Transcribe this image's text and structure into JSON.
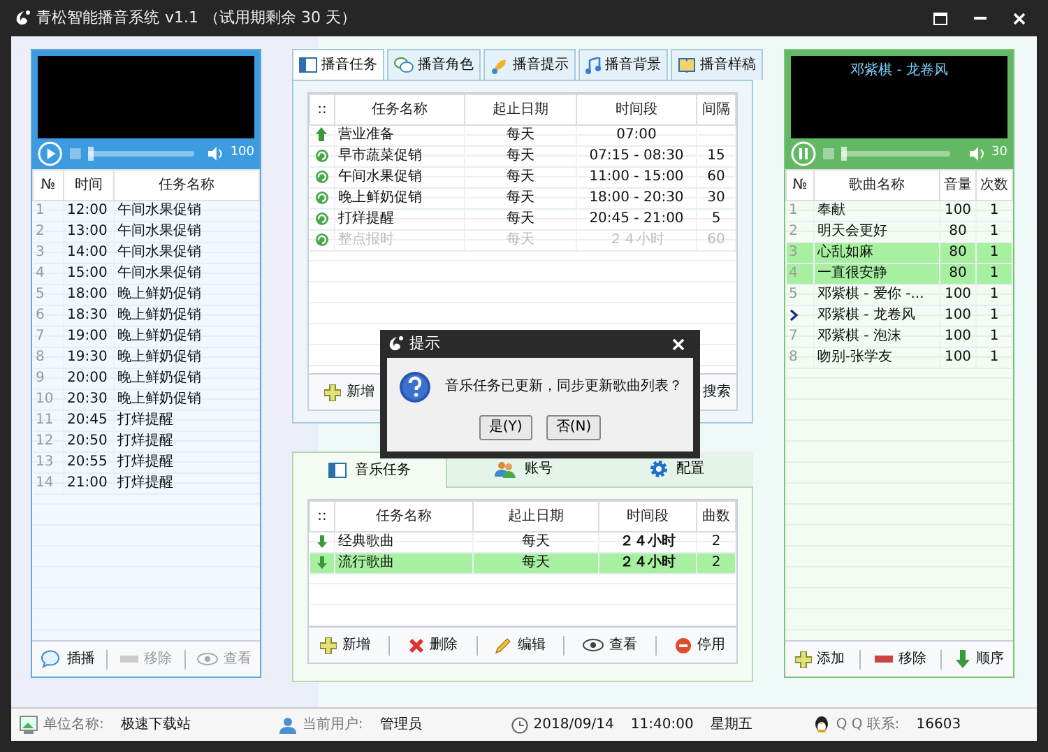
{
  "window": {
    "app_name": "青松智能播音系统",
    "version": "v1.1",
    "trial": "（试用期剩余 30 天）"
  },
  "left_player": {
    "playing": false,
    "seek": {
      "level": 0
    },
    "volume": "100"
  },
  "schedule": {
    "columns": [
      "№",
      "时间",
      "任务名称"
    ],
    "rows": [
      {
        "no": "1",
        "time": "12:00",
        "name": "午间水果促销"
      },
      {
        "no": "2",
        "time": "13:00",
        "name": "午间水果促销"
      },
      {
        "no": "3",
        "time": "14:00",
        "name": "午间水果促销"
      },
      {
        "no": "4",
        "time": "15:00",
        "name": "午间水果促销"
      },
      {
        "no": "5",
        "time": "18:00",
        "name": "晚上鲜奶促销"
      },
      {
        "no": "6",
        "time": "18:30",
        "name": "晚上鲜奶促销"
      },
      {
        "no": "7",
        "time": "19:00",
        "name": "晚上鲜奶促销"
      },
      {
        "no": "8",
        "time": "19:30",
        "name": "晚上鲜奶促销"
      },
      {
        "no": "9",
        "time": "20:00",
        "name": "晚上鲜奶促销"
      },
      {
        "no": "10",
        "time": "20:30",
        "name": "晚上鲜奶促销"
      },
      {
        "no": "11",
        "time": "20:45",
        "name": "打烊提醒"
      },
      {
        "no": "12",
        "time": "20:50",
        "name": "打烊提醒"
      },
      {
        "no": "13",
        "time": "20:55",
        "name": "打烊提醒"
      },
      {
        "no": "14",
        "time": "21:00",
        "name": "打烊提醒"
      }
    ],
    "toolbar": [
      {
        "label": "插播",
        "disabled": false
      },
      {
        "label": "移除",
        "disabled": true
      },
      {
        "label": "查看",
        "disabled": true
      }
    ]
  },
  "broadcast": {
    "tabs": [
      {
        "label": "播音任务",
        "selected": true
      },
      {
        "label": "播音角色",
        "selected": false
      },
      {
        "label": "播音提示",
        "selected": false
      },
      {
        "label": "播音背景",
        "selected": false
      },
      {
        "label": "播音样稿",
        "selected": false
      }
    ],
    "columns": [
      "::",
      "任务名称",
      "起止日期",
      "时间段",
      "间隔"
    ],
    "rows": [
      {
        "kind": "once",
        "name": "营业准备",
        "date": "每天",
        "period": "07:00",
        "interval": "",
        "disabled": false
      },
      {
        "kind": "repeat",
        "name": "早市蔬菜促销",
        "date": "每天",
        "period": "07:15 - 08:30",
        "interval": "15",
        "disabled": false
      },
      {
        "kind": "repeat",
        "name": "午间水果促销",
        "date": "每天",
        "period": "11:00 - 15:00",
        "interval": "60",
        "disabled": false
      },
      {
        "kind": "repeat",
        "name": "晚上鲜奶促销",
        "date": "每天",
        "period": "18:00 - 20:30",
        "interval": "30",
        "disabled": false
      },
      {
        "kind": "repeat",
        "name": "打烊提醒",
        "date": "每天",
        "period": "20:45 - 21:00",
        "interval": "5",
        "disabled": false
      },
      {
        "kind": "repeat",
        "name": "整点报时",
        "date": "每天",
        "period": "２４小时",
        "interval": "60",
        "disabled": true
      }
    ],
    "toolbar": [
      "新增",
      "搜索"
    ]
  },
  "music": {
    "tabs": [
      {
        "label": "音乐任务",
        "selected": true
      },
      {
        "label": "账号",
        "selected": false
      },
      {
        "label": "配置",
        "selected": false
      }
    ],
    "columns": [
      "::",
      "任务名称",
      "起止日期",
      "时间段",
      "曲数"
    ],
    "rows": [
      {
        "name": "经典歌曲",
        "date": "每天",
        "period": "２４小时",
        "count": "2",
        "selected": false
      },
      {
        "name": "流行歌曲",
        "date": "每天",
        "period": "２４小时",
        "count": "2",
        "selected": true
      }
    ],
    "toolbar": [
      "新增",
      "删除",
      "编辑",
      "查看",
      "停用"
    ]
  },
  "right_player": {
    "now_playing": "邓紫棋 - 龙卷风",
    "playing": true,
    "seek": {
      "level": 0
    },
    "volume": "30"
  },
  "songs": {
    "columns": [
      "№",
      "歌曲名称",
      "音量",
      "次数"
    ],
    "rows": [
      {
        "no": "1",
        "name": "奉献",
        "volume": "100",
        "count": "1",
        "selected": false,
        "current": false
      },
      {
        "no": "2",
        "name": "明天会更好",
        "volume": "80",
        "count": "1",
        "selected": false,
        "current": false
      },
      {
        "no": "3",
        "name": "心乱如麻",
        "volume": "80",
        "count": "1",
        "selected": true,
        "current": false
      },
      {
        "no": "4",
        "name": "一直很安静",
        "volume": "80",
        "count": "1",
        "selected": true,
        "current": false
      },
      {
        "no": "5",
        "name": "邓紫棋 - 爱你 -...",
        "volume": "100",
        "count": "1",
        "selected": false,
        "current": false
      },
      {
        "name": "邓紫棋 - 龙卷风",
        "volume": "100",
        "count": "1",
        "selected": false,
        "current": true
      },
      {
        "no": "7",
        "name": "邓紫棋 - 泡沫",
        "volume": "100",
        "count": "1",
        "selected": false,
        "current": false
      },
      {
        "no": "8",
        "name": "吻别-张学友",
        "volume": "100",
        "count": "1",
        "selected": false,
        "current": false
      }
    ],
    "toolbar": [
      "添加",
      "移除",
      "顺序"
    ]
  },
  "dialog": {
    "title": "提示",
    "message": "音乐任务已更新，同步更新歌曲列表？",
    "buttons": [
      "是(Y)",
      "否(N)"
    ]
  },
  "status_bar": {
    "unit_label": "单位名称:",
    "unit": "极速下载站",
    "user_label": "当前用户:",
    "user": "管理员",
    "date": "2018/09/14",
    "time": "11:40:00",
    "weekday": "星期五",
    "qq_label": "Q Q 联系:",
    "qq": "16603"
  }
}
